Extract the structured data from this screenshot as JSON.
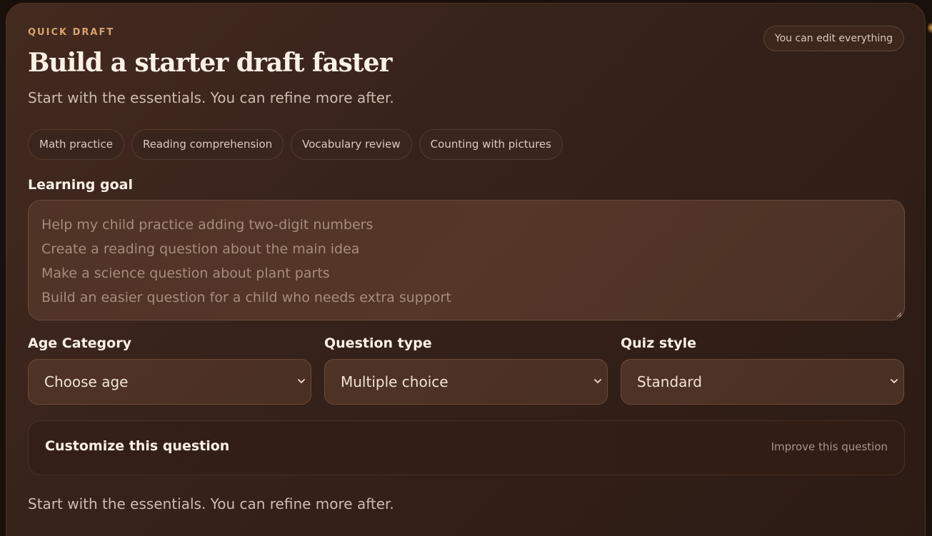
{
  "header": {
    "eyebrow": "QUICK DRAFT",
    "title": "Build a starter draft faster",
    "subtitle": "Start with the essentials. You can refine more after.",
    "edit_badge": "You can edit everything"
  },
  "chips": [
    {
      "label": "Math practice"
    },
    {
      "label": "Reading comprehension"
    },
    {
      "label": "Vocabulary review"
    },
    {
      "label": "Counting with pictures"
    }
  ],
  "learning_goal": {
    "label": "Learning goal",
    "placeholder_lines": [
      "Help my child practice adding two-digit numbers",
      "Create a reading question about the main idea",
      "Make a science question about plant parts",
      "Build an easier question for a child who needs extra support"
    ]
  },
  "selects": {
    "age": {
      "label": "Age Category",
      "value": "Choose age"
    },
    "question_type": {
      "label": "Question type",
      "value": "Multiple choice"
    },
    "quiz_style": {
      "label": "Quiz style",
      "value": "Standard"
    }
  },
  "customize": {
    "title": "Customize this question",
    "link": "Improve this question"
  },
  "footer": {
    "note": "Start with the essentials. You can refine more after."
  },
  "colors": {
    "accent": "#d7a270",
    "card_bg": "#3a251c",
    "text_primary": "#fdf1e6",
    "text_muted": "#cdbcaf"
  }
}
